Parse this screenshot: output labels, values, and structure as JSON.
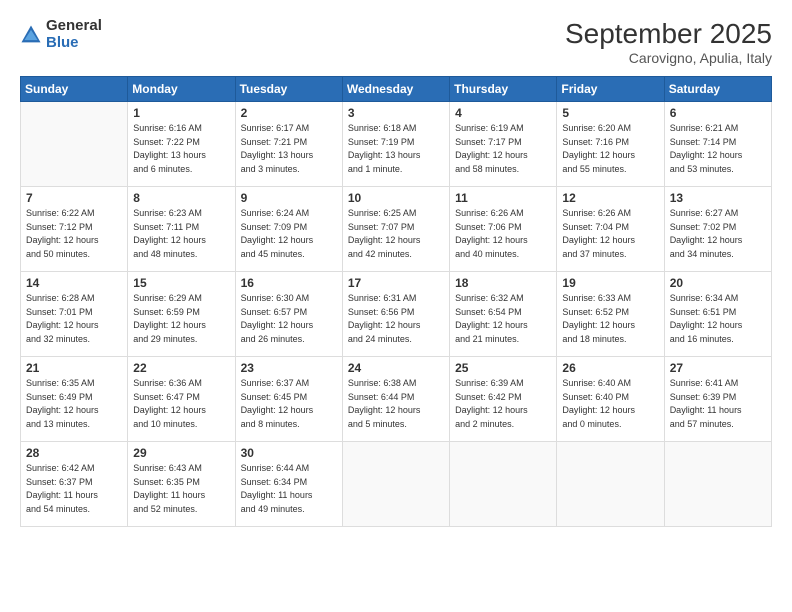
{
  "header": {
    "logo_general": "General",
    "logo_blue": "Blue",
    "month_title": "September 2025",
    "subtitle": "Carovigno, Apulia, Italy"
  },
  "days_of_week": [
    "Sunday",
    "Monday",
    "Tuesday",
    "Wednesday",
    "Thursday",
    "Friday",
    "Saturday"
  ],
  "weeks": [
    [
      {
        "day": "",
        "info": ""
      },
      {
        "day": "1",
        "info": "Sunrise: 6:16 AM\nSunset: 7:22 PM\nDaylight: 13 hours\nand 6 minutes."
      },
      {
        "day": "2",
        "info": "Sunrise: 6:17 AM\nSunset: 7:21 PM\nDaylight: 13 hours\nand 3 minutes."
      },
      {
        "day": "3",
        "info": "Sunrise: 6:18 AM\nSunset: 7:19 PM\nDaylight: 13 hours\nand 1 minute."
      },
      {
        "day": "4",
        "info": "Sunrise: 6:19 AM\nSunset: 7:17 PM\nDaylight: 12 hours\nand 58 minutes."
      },
      {
        "day": "5",
        "info": "Sunrise: 6:20 AM\nSunset: 7:16 PM\nDaylight: 12 hours\nand 55 minutes."
      },
      {
        "day": "6",
        "info": "Sunrise: 6:21 AM\nSunset: 7:14 PM\nDaylight: 12 hours\nand 53 minutes."
      }
    ],
    [
      {
        "day": "7",
        "info": "Sunrise: 6:22 AM\nSunset: 7:12 PM\nDaylight: 12 hours\nand 50 minutes."
      },
      {
        "day": "8",
        "info": "Sunrise: 6:23 AM\nSunset: 7:11 PM\nDaylight: 12 hours\nand 48 minutes."
      },
      {
        "day": "9",
        "info": "Sunrise: 6:24 AM\nSunset: 7:09 PM\nDaylight: 12 hours\nand 45 minutes."
      },
      {
        "day": "10",
        "info": "Sunrise: 6:25 AM\nSunset: 7:07 PM\nDaylight: 12 hours\nand 42 minutes."
      },
      {
        "day": "11",
        "info": "Sunrise: 6:26 AM\nSunset: 7:06 PM\nDaylight: 12 hours\nand 40 minutes."
      },
      {
        "day": "12",
        "info": "Sunrise: 6:26 AM\nSunset: 7:04 PM\nDaylight: 12 hours\nand 37 minutes."
      },
      {
        "day": "13",
        "info": "Sunrise: 6:27 AM\nSunset: 7:02 PM\nDaylight: 12 hours\nand 34 minutes."
      }
    ],
    [
      {
        "day": "14",
        "info": "Sunrise: 6:28 AM\nSunset: 7:01 PM\nDaylight: 12 hours\nand 32 minutes."
      },
      {
        "day": "15",
        "info": "Sunrise: 6:29 AM\nSunset: 6:59 PM\nDaylight: 12 hours\nand 29 minutes."
      },
      {
        "day": "16",
        "info": "Sunrise: 6:30 AM\nSunset: 6:57 PM\nDaylight: 12 hours\nand 26 minutes."
      },
      {
        "day": "17",
        "info": "Sunrise: 6:31 AM\nSunset: 6:56 PM\nDaylight: 12 hours\nand 24 minutes."
      },
      {
        "day": "18",
        "info": "Sunrise: 6:32 AM\nSunset: 6:54 PM\nDaylight: 12 hours\nand 21 minutes."
      },
      {
        "day": "19",
        "info": "Sunrise: 6:33 AM\nSunset: 6:52 PM\nDaylight: 12 hours\nand 18 minutes."
      },
      {
        "day": "20",
        "info": "Sunrise: 6:34 AM\nSunset: 6:51 PM\nDaylight: 12 hours\nand 16 minutes."
      }
    ],
    [
      {
        "day": "21",
        "info": "Sunrise: 6:35 AM\nSunset: 6:49 PM\nDaylight: 12 hours\nand 13 minutes."
      },
      {
        "day": "22",
        "info": "Sunrise: 6:36 AM\nSunset: 6:47 PM\nDaylight: 12 hours\nand 10 minutes."
      },
      {
        "day": "23",
        "info": "Sunrise: 6:37 AM\nSunset: 6:45 PM\nDaylight: 12 hours\nand 8 minutes."
      },
      {
        "day": "24",
        "info": "Sunrise: 6:38 AM\nSunset: 6:44 PM\nDaylight: 12 hours\nand 5 minutes."
      },
      {
        "day": "25",
        "info": "Sunrise: 6:39 AM\nSunset: 6:42 PM\nDaylight: 12 hours\nand 2 minutes."
      },
      {
        "day": "26",
        "info": "Sunrise: 6:40 AM\nSunset: 6:40 PM\nDaylight: 12 hours\nand 0 minutes."
      },
      {
        "day": "27",
        "info": "Sunrise: 6:41 AM\nSunset: 6:39 PM\nDaylight: 11 hours\nand 57 minutes."
      }
    ],
    [
      {
        "day": "28",
        "info": "Sunrise: 6:42 AM\nSunset: 6:37 PM\nDaylight: 11 hours\nand 54 minutes."
      },
      {
        "day": "29",
        "info": "Sunrise: 6:43 AM\nSunset: 6:35 PM\nDaylight: 11 hours\nand 52 minutes."
      },
      {
        "day": "30",
        "info": "Sunrise: 6:44 AM\nSunset: 6:34 PM\nDaylight: 11 hours\nand 49 minutes."
      },
      {
        "day": "",
        "info": ""
      },
      {
        "day": "",
        "info": ""
      },
      {
        "day": "",
        "info": ""
      },
      {
        "day": "",
        "info": ""
      }
    ]
  ]
}
